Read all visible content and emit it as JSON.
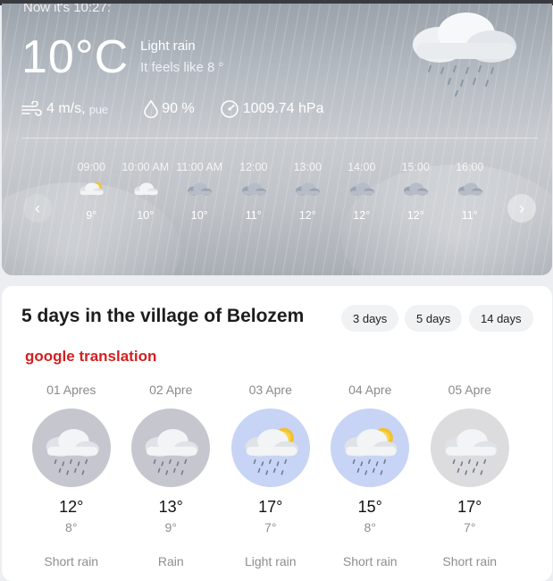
{
  "now": {
    "label": "Now it's 10:27:",
    "temperature": "10°C",
    "condition": "Light rain",
    "feels_like": "It feels like 8 °",
    "icon": "rain-cloud-icon"
  },
  "stats": {
    "wind": "4 m/s,",
    "wind_dir": "pue",
    "humidity": "90 %",
    "pressure": "1009.74 hPa"
  },
  "hourly": [
    {
      "time": "09:00",
      "temp": "9°",
      "icon": "partly-cloudy-icon"
    },
    {
      "time": "10:00 AM",
      "temp": "10°",
      "icon": "cloud-icon"
    },
    {
      "time": "11:00 AM",
      "temp": "10°",
      "icon": "dark-cloud-icon"
    },
    {
      "time": "12:00",
      "temp": "11°",
      "icon": "dark-cloud-icon"
    },
    {
      "time": "13:00",
      "temp": "12°",
      "icon": "dark-cloud-icon"
    },
    {
      "time": "14:00",
      "temp": "12°",
      "icon": "dark-cloud-icon"
    },
    {
      "time": "15:00",
      "temp": "12°",
      "icon": "dark-cloud-icon"
    },
    {
      "time": "16:00",
      "temp": "11°",
      "icon": "dark-cloud-icon"
    }
  ],
  "forecast": {
    "title": "5 days in the village of Belozem",
    "range_buttons": [
      "3 days",
      "5 days",
      "14 days"
    ],
    "translation_note": "google translation",
    "days": [
      {
        "date": "01 Apres",
        "hi": "12°",
        "lo": "8°",
        "desc": "Short rain",
        "icon": "rain-cloud-icon",
        "circle": "#c6c6cf"
      },
      {
        "date": "02 Apre",
        "hi": "13°",
        "lo": "9°",
        "desc": "Rain",
        "icon": "rain-cloud-icon",
        "circle": "#c6c6cf"
      },
      {
        "date": "03 Apre",
        "hi": "17°",
        "lo": "7°",
        "desc": "Light rain",
        "icon": "sun-rain-cloud-icon",
        "circle": "#c7d4f5"
      },
      {
        "date": "04 Apre",
        "hi": "15°",
        "lo": "8°",
        "desc": "Short rain",
        "icon": "sun-rain-cloud-icon",
        "circle": "#c7d4f5"
      },
      {
        "date": "05 Apre",
        "hi": "17°",
        "lo": "7°",
        "desc": "Short rain",
        "icon": "rain-cloud-icon",
        "circle": "#dcdcdf"
      }
    ]
  },
  "colors": {
    "title_red": "#d32020",
    "card_bg": "#ffffff"
  }
}
